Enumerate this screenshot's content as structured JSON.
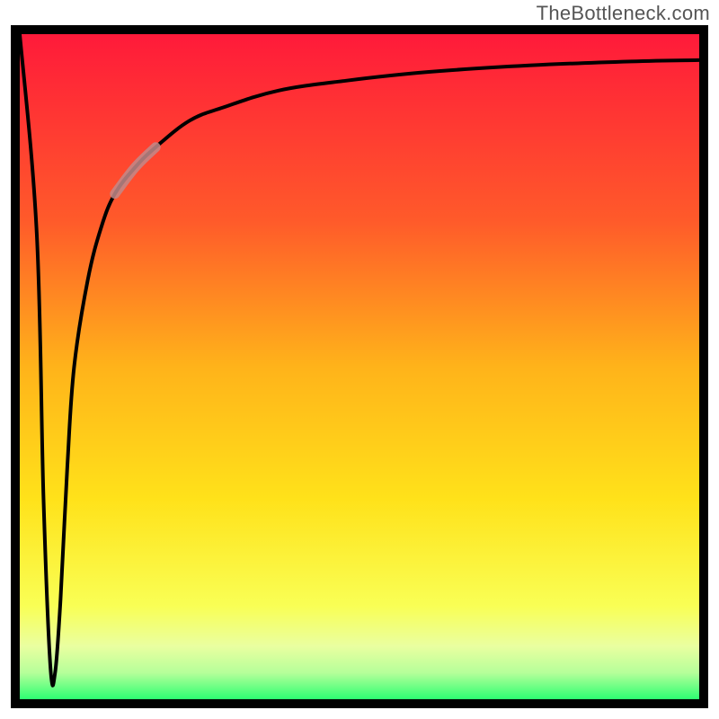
{
  "attribution": "TheBottleneck.com",
  "colors": {
    "frame": "#000000",
    "gradient_top": "#ff1a3a",
    "gradient_mid1": "#ff7a1f",
    "gradient_mid2": "#ffe21a",
    "gradient_mid3": "#f6ff4d",
    "gradient_bottom_band": "#d9ffb0",
    "gradient_bottom": "#2dff72",
    "curve": "#000000",
    "highlight": "#c28a8a"
  },
  "chart_data": {
    "type": "line",
    "title": "",
    "xlabel": "",
    "ylabel": "",
    "x_range": [
      0,
      100
    ],
    "y_range": [
      0,
      100
    ],
    "series": [
      {
        "name": "bottleneck-curve",
        "x": [
          0,
          2.5,
          3.5,
          4.5,
          5.2,
          6,
          7,
          8,
          10,
          12,
          14,
          17,
          20,
          25,
          30,
          38,
          48,
          60,
          75,
          90,
          100
        ],
        "y": [
          100,
          70,
          30,
          5,
          4,
          15,
          35,
          50,
          63,
          71,
          76,
          80,
          83,
          87,
          89,
          91.5,
          93,
          94.3,
          95.3,
          95.9,
          96.1
        ]
      },
      {
        "name": "highlight-segment",
        "x": [
          14,
          17,
          20
        ],
        "y": [
          76,
          80,
          83
        ]
      }
    ],
    "notes": "y values are estimated as percent of plot height from bottom; curve starts near top-left, plunges to near bottom just after x≈5, then rises asymptotically toward y≈96. A short washed-out brownish segment highlights the curve near x 14–20."
  }
}
